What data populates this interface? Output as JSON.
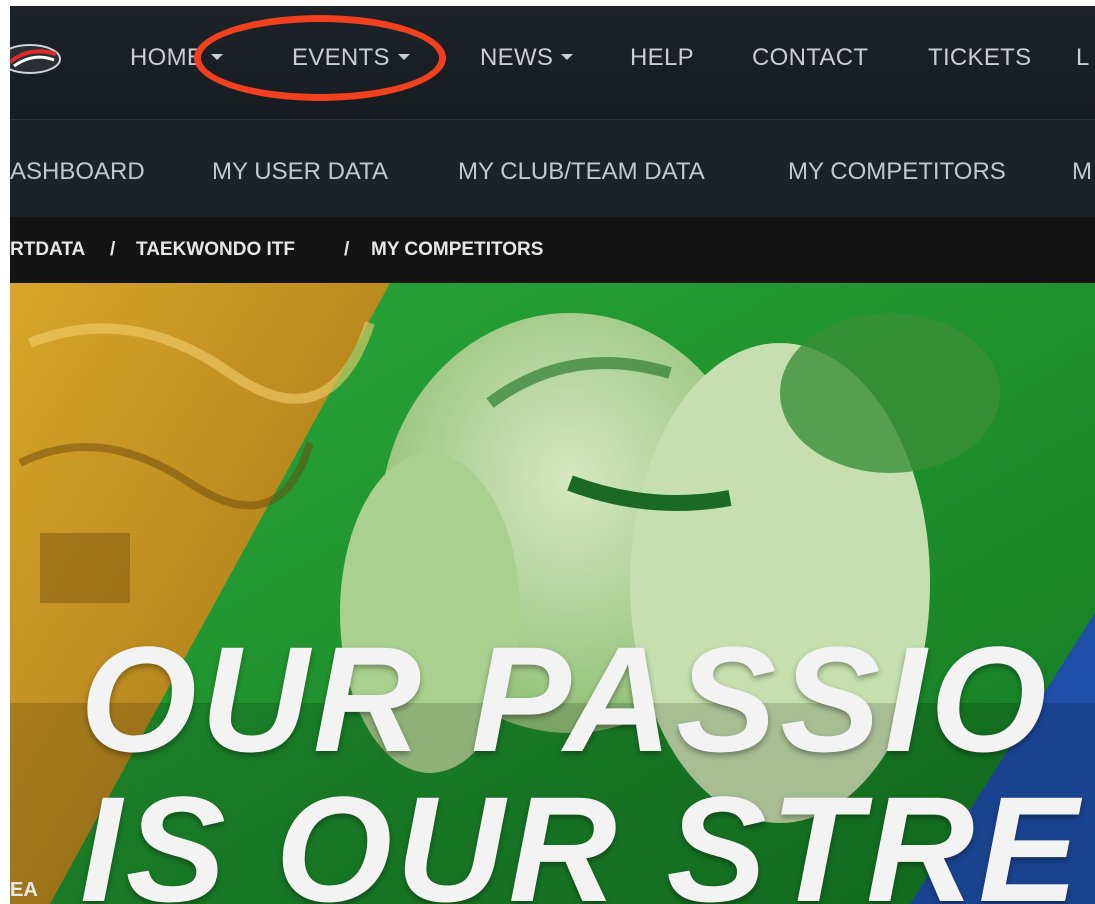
{
  "top_nav": {
    "items": [
      {
        "label": "HOME",
        "has_caret": true
      },
      {
        "label": "EVENTS",
        "has_caret": true
      },
      {
        "label": "NEWS",
        "has_caret": true
      },
      {
        "label": "HELP",
        "has_caret": false
      },
      {
        "label": "CONTACT",
        "has_caret": false
      },
      {
        "label": "TICKETS",
        "has_caret": false
      },
      {
        "label": "L",
        "has_caret": false
      }
    ],
    "highlight_color": "#f0401f"
  },
  "sub_nav": {
    "items": [
      {
        "label": "ASHBOARD"
      },
      {
        "label": "MY USER DATA"
      },
      {
        "label": "MY CLUB/TEAM DATA"
      },
      {
        "label": "MY COMPETITORS"
      },
      {
        "label": "M"
      }
    ]
  },
  "breadcrumb": {
    "items": [
      "RTDATA",
      "TAEKWONDO ITF",
      "MY COMPETITORS"
    ],
    "separator": "/"
  },
  "hero": {
    "line1": "OUR PASSIO",
    "line2": "IS OUR STRE",
    "corner": "EA",
    "colors": {
      "gold": "#c9961e",
      "green": "#1f8f2c",
      "light_green": "#b9d9a0",
      "blue": "#1f4fa8"
    }
  },
  "icons": {
    "logo": "brand-logo-icon",
    "caret": "caret-down-icon"
  }
}
